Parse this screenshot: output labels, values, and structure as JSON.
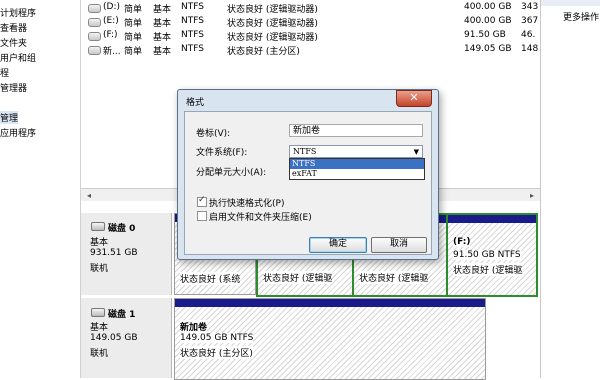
{
  "tree": {
    "items": [
      "计划程序",
      "查看器",
      "文件夹",
      "用户和组",
      "程",
      "管理器",
      "",
      "管理",
      "应用程序"
    ]
  },
  "volumes": [
    {
      "name": "(D:)",
      "layout": "简单",
      "type": "基本",
      "fs": "NTFS",
      "status": "状态良好 (逻辑驱动器)",
      "capacity": "400.00 GB",
      "free": "343"
    },
    {
      "name": "(E:)",
      "layout": "简单",
      "type": "基本",
      "fs": "NTFS",
      "status": "状态良好 (逻辑驱动器)",
      "capacity": "400.00 GB",
      "free": "367"
    },
    {
      "name": "(F:)",
      "layout": "简单",
      "type": "基本",
      "fs": "NTFS",
      "status": "状态良好 (逻辑驱动器)",
      "capacity": "91.50 GB",
      "free": "46."
    },
    {
      "name": "新...",
      "layout": "简单",
      "type": "基本",
      "fs": "NTFS",
      "status": "状态良好 (主分区)",
      "capacity": "149.05 GB",
      "free": "148"
    }
  ],
  "actions": {
    "more": "更多操作"
  },
  "disks": [
    {
      "name": "磁盘 0",
      "type": "基本",
      "size": "931.51 GB",
      "status": "联机"
    },
    {
      "name": "磁盘 1",
      "type": "基本",
      "size": "149.05 GB",
      "status": "联机"
    }
  ],
  "disk0_parts": {
    "p1_status": "状态良好 (系统",
    "p2_status": "状态良好 (逻辑驱",
    "p3_status": "状态良好 (逻辑驱",
    "f_name": "(F:)",
    "f_size": "91.50 GB NTFS",
    "f_status": "状态良好 (逻辑驱"
  },
  "disk1_part": {
    "name": "新加卷",
    "size": "149.05 GB NTFS",
    "status": "状态良好 (主分区)"
  },
  "dialog": {
    "title": "格式",
    "close": "✕",
    "label_volume": "卷标(V):",
    "volume_value": "新加卷",
    "label_fs": "文件系统(F):",
    "fs_selected": "NTFS",
    "fs_options": [
      "NTFS",
      "exFAT"
    ],
    "label_alloc": "分配单元大小(A):",
    "quick_format": "执行快速格式化(P)",
    "quick_format_checked": true,
    "compression": "启用文件和文件夹压缩(E)",
    "compression_checked": false,
    "ok": "确定",
    "cancel": "取消"
  }
}
